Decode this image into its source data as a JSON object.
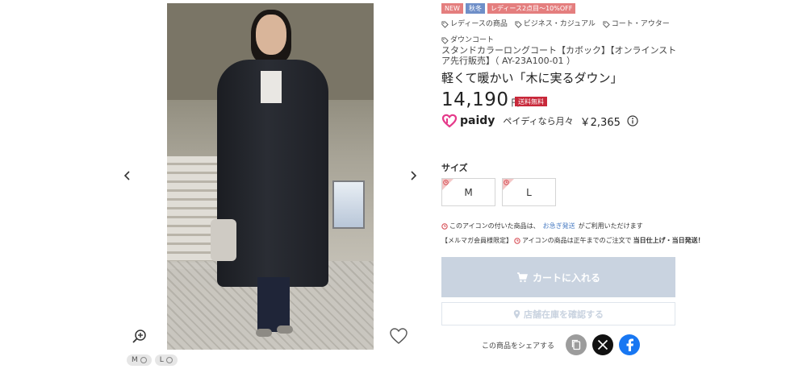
{
  "gallery": {
    "prev_icon": "chevron-left-icon",
    "next_icon": "chevron-right-icon",
    "zoom_icon": "zoom-in-icon",
    "favorite_icon": "heart-icon",
    "thumbnails": [
      {
        "label": "M"
      },
      {
        "label": "L"
      }
    ]
  },
  "badges": {
    "new": "NEW",
    "season": "秋冬",
    "sale": "レディース2点目～10%OFF"
  },
  "tags": [
    "レディースの商品",
    "ビジネス・カジュアル",
    "コート・アウター",
    "ダウンコート"
  ],
  "product": {
    "name": "スタンドカラーロングコート【カボック】【オンラインストア先行販売】（ AY-23A100-01 ）",
    "catch": "軽くて暖かい「木に実るダウン」",
    "price": "14,190",
    "yen": "円",
    "shipping": "送料無料"
  },
  "paidy": {
    "brand": "paidy",
    "text": "ペイディなら月々",
    "amount": "￥2,365"
  },
  "size": {
    "label": "サイズ",
    "options": [
      "M",
      "L"
    ]
  },
  "notes": {
    "line1_before": "このアイコンの付いた商品は、",
    "line1_link": "お急ぎ発送",
    "line1_after": "がご利用いただけます",
    "line2_prefix": "【メルマガ会員様限定】",
    "line2_mid": "アイコンの商品は正午までのご注文で",
    "line2_bold": "当日仕上げ・当日発送！"
  },
  "actions": {
    "cart": "カートに入れる",
    "store": "店舗在庫を確認する"
  },
  "share": {
    "label": "この商品をシェアする"
  },
  "colors": {
    "accent_red": "#c8283a",
    "cart_disabled": "#c9d3e0",
    "link": "#4b7dc3",
    "paidy_pink": "#e5398a",
    "facebook": "#1877f2"
  }
}
